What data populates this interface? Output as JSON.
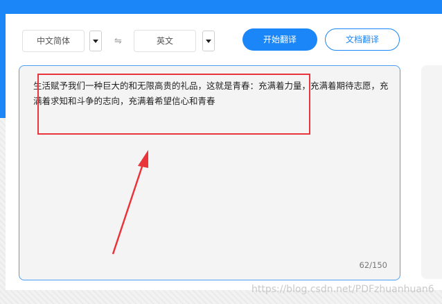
{
  "toolbar": {
    "source_lang": "中文简体",
    "swap_symbol": "⇋",
    "target_lang": "英文",
    "translate_button": "开始翻译",
    "doc_translate_button": "文档翻译"
  },
  "editor": {
    "text": "生活赋予我们一种巨大的和无限高贵的礼品，这就是青春：充满着力量，充满着期待志愿，充满着求知和斗争的志向，充满着希望信心和青春",
    "counter": "62/150"
  },
  "watermark": "https://blog.csdn.net/PDFzhuanhuan6",
  "colors": {
    "accent": "#1a86f7",
    "annotation_red": "#e8343a"
  },
  "icons": {
    "dropdown": "chevron-down-icon",
    "swap": "swap-icon"
  }
}
